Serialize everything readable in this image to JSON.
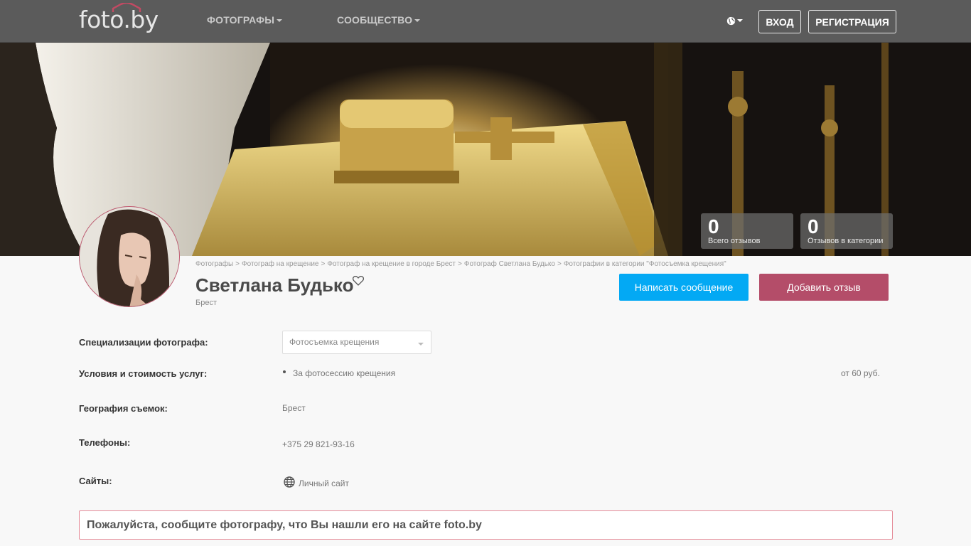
{
  "header": {
    "logo_text": "foto.by",
    "nav": [
      {
        "label": "ФОТОГРАФЫ"
      },
      {
        "label": "СООБЩЕСТВО"
      }
    ],
    "login_label": "ВХОД",
    "register_label": "РЕГИСТРАЦИЯ"
  },
  "stats": {
    "total_reviews": {
      "value": "0",
      "label": "Всего отзывов"
    },
    "category_reviews": {
      "value": "0",
      "label": "Отзывов в категории"
    }
  },
  "profile": {
    "breadcrumb": [
      "Фотографы",
      "Фотограф на крещение",
      "Фотограф на крещение в городе Брест",
      "Фотограф Светлана Будько",
      "Фотографии в категории \"Фотосъемка крещения\""
    ],
    "breadcrumb_separator": ">",
    "name": "Светлана Будько",
    "city": "Брест",
    "message_button": "Написать сообщение",
    "review_button": "Добавить отзыв"
  },
  "details": {
    "specializations_label": "Специализации фотографа:",
    "specialization_selected": "Фотосъемка крещения",
    "services_label": "Условия и стоимость услуг:",
    "service_name": "За фотосессию крещения",
    "service_price": "от 60 руб.",
    "geography_label": "География съемок:",
    "geography_value": "Брест",
    "phones_label": "Телефоны:",
    "phone": "+375 29 821-93-16",
    "sites_label": "Сайты:",
    "site_link": "Личный сайт"
  },
  "notice": "Пожалуйста, сообщите фотографу, что Вы нашли его на сайте foto.by",
  "colors": {
    "topbar": "#5b5b5b",
    "message_button": "#03a9f4",
    "review_button": "#b44d69",
    "notice_border": "#e58b98"
  }
}
